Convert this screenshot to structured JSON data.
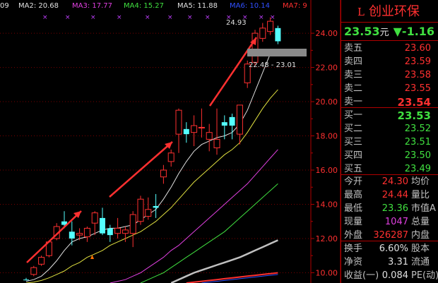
{
  "stock": {
    "name": "创业环保",
    "prefix_icon": "L",
    "price": "23.53",
    "price_unit": "元",
    "change": "▼-1.16"
  },
  "ma_bar": {
    "left_cut": "09",
    "items": [
      {
        "label": "MA2: 20.68",
        "color": "#e0e0e0"
      },
      {
        "label": "MA3: 17.77",
        "color": "#e040e0"
      },
      {
        "label": "MA4: 15.27",
        "color": "#40e040"
      },
      {
        "label": "MA5: 11.88",
        "color": "#e0e0e0"
      },
      {
        "label": "MA6: 10.14",
        "color": "#3050ff"
      },
      {
        "label": "MA7: 9",
        "color": "#ff3030"
      }
    ]
  },
  "axis": {
    "ticks": [
      "24.00",
      "22.00",
      "20.00",
      "18.00",
      "16.00",
      "14.00",
      "12.00",
      "10.00"
    ]
  },
  "annotations": {
    "high_label": "24.93",
    "range_label": "22.48 - 23.01"
  },
  "order_book": {
    "sell": [
      {
        "label": "卖五",
        "price": "23.60"
      },
      {
        "label": "卖四",
        "price": "23.59"
      },
      {
        "label": "卖三",
        "price": "23.58"
      },
      {
        "label": "卖二",
        "price": "23.55"
      },
      {
        "label": "卖一",
        "price": "23.54"
      }
    ],
    "buy": [
      {
        "label": "买一",
        "price": "23.53"
      },
      {
        "label": "买二",
        "price": "23.52"
      },
      {
        "label": "买三",
        "price": "23.51"
      },
      {
        "label": "买四",
        "price": "23.50"
      },
      {
        "label": "买五",
        "price": "23.49"
      }
    ]
  },
  "stats": [
    {
      "label": "今开",
      "value": "24.30",
      "right": "均价",
      "color": "#ff3030"
    },
    {
      "label": "最高",
      "value": "24.44",
      "right": "量比",
      "color": "#ff3030"
    },
    {
      "label": "最低",
      "value": "23.36",
      "right": "市值A",
      "color": "#40e040"
    },
    {
      "label": "现量",
      "value": "1047",
      "right": "总量",
      "color": "#e040e0"
    },
    {
      "label": "外盘",
      "value": "326287",
      "right": "内盘",
      "color": "#ff3030"
    }
  ],
  "stats2": [
    {
      "label": "换手",
      "value": "6.60%",
      "right": "股本",
      "color": "#e0e0e0"
    },
    {
      "label": "净资",
      "value": "3.31",
      "right": "流通",
      "color": "#e0e0e0"
    },
    {
      "label": "收益(一)",
      "value": "0.084",
      "right": "PE(动)",
      "color": "#e0e0e0"
    }
  ],
  "chart_data": {
    "type": "candlestick",
    "ylim": [
      9.4,
      25.2
    ],
    "candles": [
      {
        "o": 9.6,
        "h": 9.7,
        "l": 9.55,
        "c": 9.6,
        "up": false
      },
      {
        "o": 9.9,
        "h": 10.4,
        "l": 9.8,
        "c": 10.3,
        "up": true
      },
      {
        "o": 10.5,
        "h": 11.0,
        "l": 10.4,
        "c": 10.9,
        "up": true
      },
      {
        "o": 11.0,
        "h": 11.8,
        "l": 10.9,
        "c": 11.8,
        "up": true
      },
      {
        "o": 12.0,
        "h": 12.9,
        "l": 11.9,
        "c": 12.7,
        "up": true
      },
      {
        "o": 12.8,
        "h": 13.6,
        "l": 12.6,
        "c": 13.0,
        "up": false
      },
      {
        "o": 12.4,
        "h": 13.0,
        "l": 11.6,
        "c": 12.0,
        "up": false
      },
      {
        "o": 12.2,
        "h": 12.6,
        "l": 11.9,
        "c": 12.3,
        "up": true
      },
      {
        "o": 12.1,
        "h": 12.7,
        "l": 11.8,
        "c": 12.6,
        "up": true
      },
      {
        "o": 12.9,
        "h": 13.6,
        "l": 12.2,
        "c": 13.5,
        "up": true
      },
      {
        "o": 13.2,
        "h": 13.8,
        "l": 12.2,
        "c": 12.3,
        "up": false
      },
      {
        "o": 12.2,
        "h": 12.8,
        "l": 11.8,
        "c": 12.6,
        "up": false
      },
      {
        "o": 12.6,
        "h": 13.2,
        "l": 12.0,
        "c": 12.3,
        "up": true
      },
      {
        "o": 12.3,
        "h": 12.7,
        "l": 11.8,
        "c": 12.5,
        "up": true
      },
      {
        "o": 12.3,
        "h": 13.6,
        "l": 11.5,
        "c": 13.4,
        "up": true
      },
      {
        "o": 13.0,
        "h": 14.5,
        "l": 12.8,
        "c": 14.3,
        "up": true
      },
      {
        "o": 13.3,
        "h": 14.4,
        "l": 13.1,
        "c": 13.7,
        "up": true
      },
      {
        "o": 13.8,
        "h": 14.6,
        "l": 13.2,
        "c": 13.9,
        "up": false
      },
      {
        "o": 15.6,
        "h": 16.3,
        "l": 15.2,
        "c": 16.0,
        "up": true
      },
      {
        "o": 16.5,
        "h": 17.2,
        "l": 16.2,
        "c": 17.0,
        "up": true
      },
      {
        "o": 18.1,
        "h": 19.6,
        "l": 17.0,
        "c": 19.5,
        "up": true
      },
      {
        "o": 18.4,
        "h": 18.8,
        "l": 17.6,
        "c": 18.1,
        "up": false
      },
      {
        "o": 18.2,
        "h": 19.2,
        "l": 17.4,
        "c": 18.6,
        "up": true
      },
      {
        "o": 18.5,
        "h": 19.6,
        "l": 17.9,
        "c": 18.5,
        "up": true
      },
      {
        "o": 17.8,
        "h": 18.7,
        "l": 17.1,
        "c": 18.2,
        "up": true
      },
      {
        "o": 17.8,
        "h": 19.6,
        "l": 16.9,
        "c": 17.3,
        "up": true
      },
      {
        "o": 18.6,
        "h": 19.2,
        "l": 17.8,
        "c": 18.8,
        "up": false
      },
      {
        "o": 18.6,
        "h": 19.3,
        "l": 17.8,
        "c": 19.1,
        "up": false
      },
      {
        "o": 18.1,
        "h": 19.3,
        "l": 17.5,
        "c": 19.8,
        "up": true
      },
      {
        "o": 21.1,
        "h": 22.4,
        "l": 20.8,
        "c": 22.2,
        "up": true
      },
      {
        "o": 22.3,
        "h": 24.2,
        "l": 22.1,
        "c": 24.0,
        "up": true
      },
      {
        "o": 23.7,
        "h": 24.6,
        "l": 23.5,
        "c": 24.3,
        "up": true
      },
      {
        "o": 24.1,
        "h": 24.93,
        "l": 23.9,
        "c": 24.7,
        "up": true
      },
      {
        "o": 24.3,
        "h": 24.44,
        "l": 23.36,
        "c": 23.53,
        "up": false
      }
    ],
    "ma_lines": [
      {
        "name": "MA2",
        "color": "#e0e0e0",
        "values": [
          9.5,
          9.6,
          9.8,
          10.2,
          10.7,
          11.3,
          11.8,
          12.0,
          12.1,
          12.3,
          12.5,
          12.6,
          12.6,
          12.7,
          12.8,
          13.1,
          13.4,
          13.7,
          14.3,
          15.0,
          15.8,
          16.5,
          17.1,
          17.5,
          17.7,
          17.9,
          18.0,
          18.2,
          18.7,
          19.5,
          20.6,
          21.7,
          22.8,
          23.0
        ]
      },
      {
        "name": "MA3",
        "color": "#e0e040",
        "values": [
          9.4,
          9.45,
          9.55,
          9.7,
          9.9,
          10.1,
          10.4,
          10.6,
          10.9,
          11.1,
          11.3,
          11.6,
          11.8,
          12.0,
          12.2,
          12.4,
          12.7,
          13.0,
          13.4,
          13.8,
          14.3,
          14.8,
          15.3,
          15.7,
          16.1,
          16.5,
          16.9,
          17.2,
          17.6,
          18.2,
          18.9,
          19.6,
          20.2,
          20.7
        ]
      },
      {
        "name": "MA4",
        "color": "#e040e0",
        "values": [
          null,
          null,
          null,
          null,
          null,
          null,
          null,
          null,
          null,
          null,
          null,
          9.4,
          9.5,
          9.6,
          9.8,
          10.0,
          10.3,
          10.6,
          10.9,
          11.3,
          11.6,
          12.0,
          12.4,
          12.8,
          13.2,
          13.6,
          14.0,
          14.4,
          14.8,
          15.2,
          15.7,
          16.2,
          16.7,
          17.2
        ]
      },
      {
        "name": "MA5",
        "color": "#40e040",
        "values": [
          null,
          null,
          null,
          null,
          null,
          null,
          null,
          null,
          null,
          null,
          null,
          null,
          null,
          null,
          null,
          9.4,
          9.6,
          9.8,
          10.0,
          10.3,
          10.6,
          10.9,
          11.2,
          11.5,
          11.8,
          12.1,
          12.4,
          12.8,
          13.2,
          13.6,
          14.0,
          14.4,
          14.8,
          15.2
        ]
      },
      {
        "name": "MA6",
        "color": "#c0c0c0",
        "values": [
          null,
          null,
          null,
          null,
          null,
          null,
          null,
          null,
          null,
          null,
          null,
          null,
          null,
          null,
          null,
          null,
          null,
          null,
          null,
          9.4,
          9.6,
          9.8,
          10.0,
          10.15,
          10.3,
          10.45,
          10.6,
          10.75,
          10.9,
          11.1,
          11.3,
          11.5,
          11.7,
          11.9
        ]
      },
      {
        "name": "MA7",
        "color": "#ff3030",
        "values": [
          null,
          null,
          null,
          null,
          null,
          null,
          null,
          null,
          null,
          null,
          null,
          null,
          null,
          null,
          null,
          null,
          null,
          null,
          null,
          null,
          null,
          9.4,
          9.45,
          9.5,
          9.55,
          9.6,
          9.65,
          9.7,
          9.75,
          9.8,
          9.85,
          9.9,
          9.95,
          10.0
        ]
      },
      {
        "name": "MA8",
        "color": "#3050ff",
        "values": [
          null,
          null,
          null,
          null,
          null,
          null,
          null,
          null,
          null,
          null,
          null,
          null,
          null,
          null,
          null,
          null,
          null,
          null,
          null,
          null,
          null,
          null,
          null,
          9.4,
          9.45,
          9.5,
          9.55,
          9.6,
          9.65,
          9.7,
          9.75,
          9.8,
          9.85,
          9.9
        ]
      }
    ]
  }
}
